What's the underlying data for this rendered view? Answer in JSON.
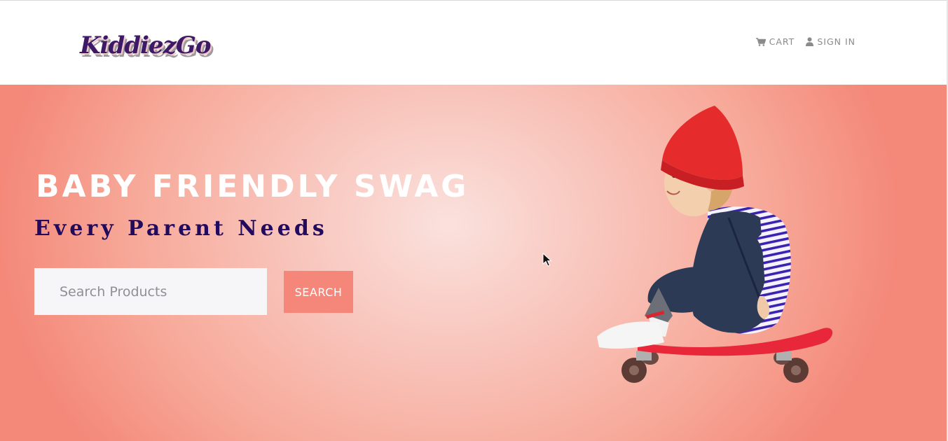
{
  "brand": {
    "logo_text": "KiddiezGo"
  },
  "nav": {
    "cart_label": "CART",
    "signin_label": "SIGN IN",
    "cart_icon": "shopping-cart-icon",
    "signin_icon": "user-icon"
  },
  "hero": {
    "title": "BABY FRIENDLY SWAG",
    "subtitle": "Every Parent Needs",
    "search": {
      "placeholder": "Search Products",
      "value": "",
      "button_label": "SEARCH"
    },
    "image": {
      "alt": "Toddler in red beanie and striped shirt sitting on a red skateboard"
    }
  },
  "colors": {
    "accent": "#f4877a",
    "subtitle": "#220a5e",
    "nav_text": "#8a8a8a"
  }
}
